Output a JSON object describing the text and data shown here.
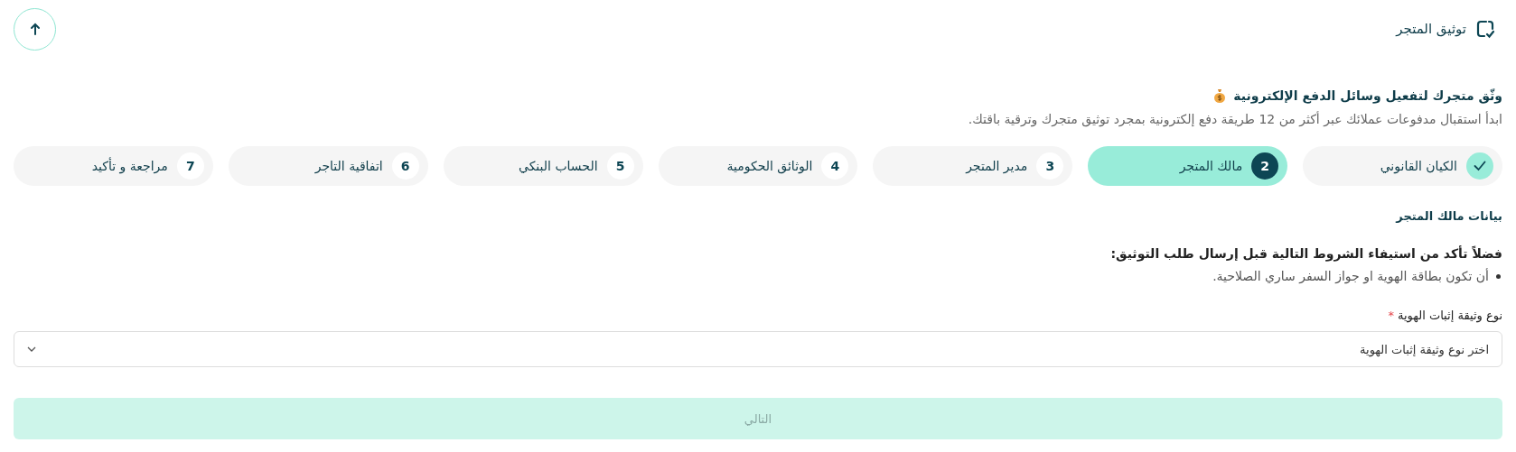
{
  "header": {
    "title": "توثيق المتجر"
  },
  "intro": {
    "heading": "وثّق متجرك لتفعيل وسائل الدفع الإلكترونية",
    "description": "ابدأ استقبال مدفوعات عملائك عبر أكثر من 12 طريقة دفع إلكترونية بمجرد توثيق متجرك وترقية باقتك."
  },
  "steps": [
    {
      "label": "الكيان القانوني",
      "completed": true,
      "selected": false
    },
    {
      "number": "2",
      "label": "مالك المتجر",
      "completed": false,
      "selected": true
    },
    {
      "number": "3",
      "label": "مدير المتجر",
      "completed": false,
      "selected": false
    },
    {
      "number": "4",
      "label": "الوثائق الحكومية",
      "completed": false,
      "selected": false
    },
    {
      "number": "5",
      "label": "الحساب البنكي",
      "completed": false,
      "selected": false
    },
    {
      "number": "6",
      "label": "اتفاقية التاجر",
      "completed": false,
      "selected": false
    },
    {
      "number": "7",
      "label": "مراجعة و تأكيد",
      "completed": false,
      "selected": false
    }
  ],
  "section": {
    "title": "بيانات مالك المتجر",
    "requirements_title": "فضلاً تأكد من استيفاء الشروط التالية قبل إرسال طلب التوثيق:",
    "requirements": [
      "أن تكون بطاقة الهوية او جواز السفر ساري الصلاحية."
    ]
  },
  "form": {
    "label": "نوع وثيقة إثبات الهوية",
    "required_mark": "*",
    "placeholder": "اختر نوع وثيقة إثبات الهوية"
  },
  "next_button": {
    "label": "التالي",
    "disabled": true
  }
}
